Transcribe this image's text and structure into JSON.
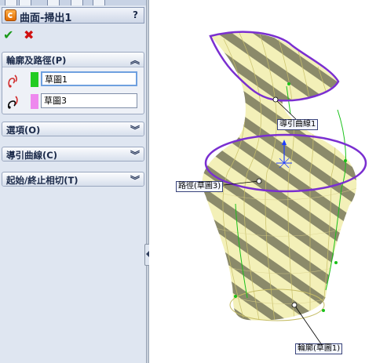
{
  "window": {
    "title": "曲面-掃出1",
    "help_label": "?"
  },
  "actions": {
    "ok_glyph": "✔",
    "cancel_glyph": "✖"
  },
  "groups": {
    "profile_path": {
      "label": "輪廓及路徑(P)",
      "expanded": true,
      "rows": [
        {
          "value": "草圖1",
          "swatch": "#22cc22",
          "active": true
        },
        {
          "value": "草圖3",
          "swatch": "#ee88ee",
          "active": false
        }
      ]
    },
    "options": {
      "label": "選項(O)",
      "expanded": false
    },
    "guide_curves": {
      "label": "導引曲線(C)",
      "expanded": false
    },
    "tangency": {
      "label": "起始/終止相切(T)",
      "expanded": false
    }
  },
  "graphics": {
    "callouts": {
      "guide_curve": "導引曲線1",
      "path": "路徑(草圖3)",
      "profile": "輪廓(草圖1)"
    },
    "colors": {
      "surface": "#f3f0b8",
      "surface_lines": "#c9c06a",
      "zebra_dark": "#8b8a6a",
      "sweep_curve": "#7a2fd0",
      "sketch_green": "#19c119"
    }
  }
}
